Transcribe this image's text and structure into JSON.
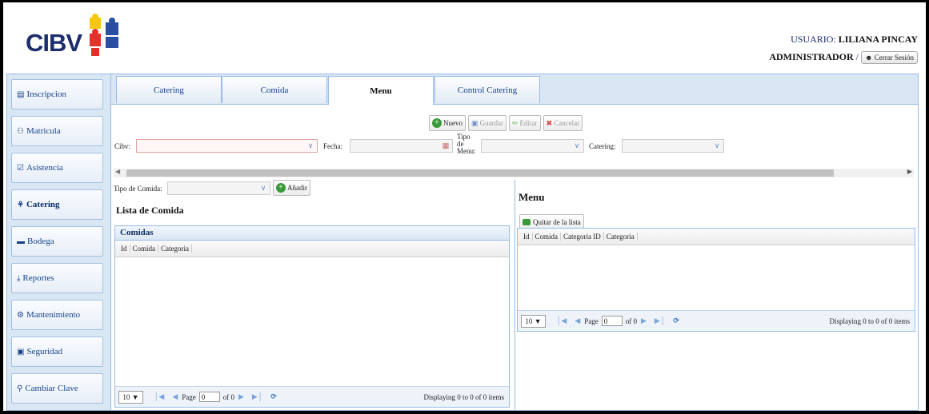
{
  "header": {
    "logo_text": "CIBV",
    "user_label": "USUARIO:",
    "user_name": "LILIANA PINCAY",
    "role": "ADMINISTRADOR",
    "role_sep": "/",
    "logout_label": "Cerrar Sesión"
  },
  "sidebar": {
    "items": [
      {
        "label": "Inscripcion",
        "icon": "list-icon"
      },
      {
        "label": "Matricula",
        "icon": "users-icon"
      },
      {
        "label": "Asistencia",
        "icon": "check-square-icon"
      },
      {
        "label": "Catering",
        "icon": "cutlery-icon"
      },
      {
        "label": "Bodega",
        "icon": "inbox-icon"
      },
      {
        "label": "Reportes",
        "icon": "download-icon"
      },
      {
        "label": "Mantenimiento",
        "icon": "gears-icon"
      },
      {
        "label": "Seguridad",
        "icon": "lock-icon"
      },
      {
        "label": "Cambiar Clave",
        "icon": "key-icon"
      }
    ],
    "active": "Catering"
  },
  "tabs": [
    {
      "label": "Catering"
    },
    {
      "label": "Comida"
    },
    {
      "label": "Menu"
    },
    {
      "label": "Control Catering"
    }
  ],
  "active_tab": "Menu",
  "toolbar": {
    "nuevo": "Nuevo",
    "guardar": "Guardar",
    "editar": "Editar",
    "cancelar": "Cancelar"
  },
  "form": {
    "cibv_label": "Cibv:",
    "cibv_value": "",
    "fecha_label": "Fecha:",
    "fecha_value": "",
    "tipo_menu_label_1": "Tipo",
    "tipo_menu_label_2": "de",
    "tipo_menu_label_3": "Menu:",
    "tipo_menu_value": "",
    "catering_label": "Catering:",
    "catering_value": ""
  },
  "left": {
    "tipo_comida_label": "Tipo de Comida:",
    "tipo_comida_value": "",
    "anadir_label": "Añadir",
    "lista_title": "Lista de Comida",
    "grid_title": "Comidas",
    "columns": [
      "Id",
      "Comida",
      "Categoria"
    ],
    "pager": {
      "page_size": "10",
      "page_label": "Page",
      "page_value": "0",
      "of_label": "of 0",
      "display_text": "Displaying 0 to 0 of 0 items"
    }
  },
  "right": {
    "title": "Menu",
    "quitar_label": "Quitar de la lista",
    "columns": [
      "Id",
      "Comida",
      "Categoria ID",
      "Categoria"
    ],
    "pager": {
      "page_size": "10",
      "page_label": "Page",
      "page_value": "0",
      "of_label": "of 0",
      "display_text": "Displaying 0 to 0 of 0 items"
    }
  },
  "colors": {
    "accent": "#15428b",
    "panel_border": "#99bbe8",
    "panel_bg": "#d9e7f4",
    "logo_blue": "#1c2d6b",
    "puzzle_yellow": "#f7c517",
    "puzzle_red": "#e2332a",
    "puzzle_blue": "#2a4fa0",
    "add_green": "#3a9a3a",
    "cancel_red": "#d9534f"
  }
}
